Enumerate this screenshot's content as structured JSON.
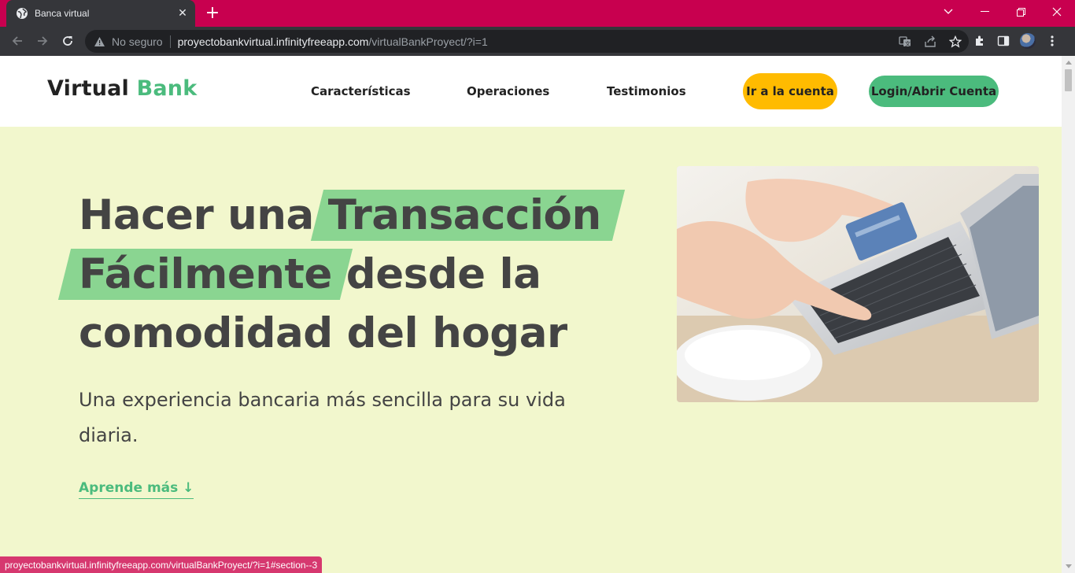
{
  "browser": {
    "tab_title": "Banca virtual",
    "security_label": "No seguro",
    "url_host": "proyectobankvirtual.infinityfreeapp.com",
    "url_path": "/virtualBankProyect/?i=1",
    "status_url": "proyectobankvirtual.infinityfreeapp.com/virtualBankProyect/?i=1#section--3",
    "titlebar_color": "#c8004f"
  },
  "site": {
    "logo_main": "Virtual",
    "logo_accent": "Bank",
    "nav": {
      "features": "Características",
      "operations": "Operaciones",
      "testimonials": "Testimonios",
      "go_account": "Ir a la cuenta",
      "login": "Login/Abrir Cuenta"
    },
    "hero": {
      "title_part1": "Hacer una",
      "title_highlight1": "Transacción",
      "title_highlight2": "Fácilmente",
      "title_part2": "desde la",
      "title_line3": "comodidad del hogar",
      "subtitle": "Una experiencia bancaria más sencilla para su vida diaria.",
      "learn_more": "Aprende más ↓"
    },
    "colors": {
      "background": "#f2f7cd",
      "accent_green": "#4bbb7d",
      "highlight_green": "#8ad591",
      "button_yellow": "#ffbb00"
    }
  }
}
